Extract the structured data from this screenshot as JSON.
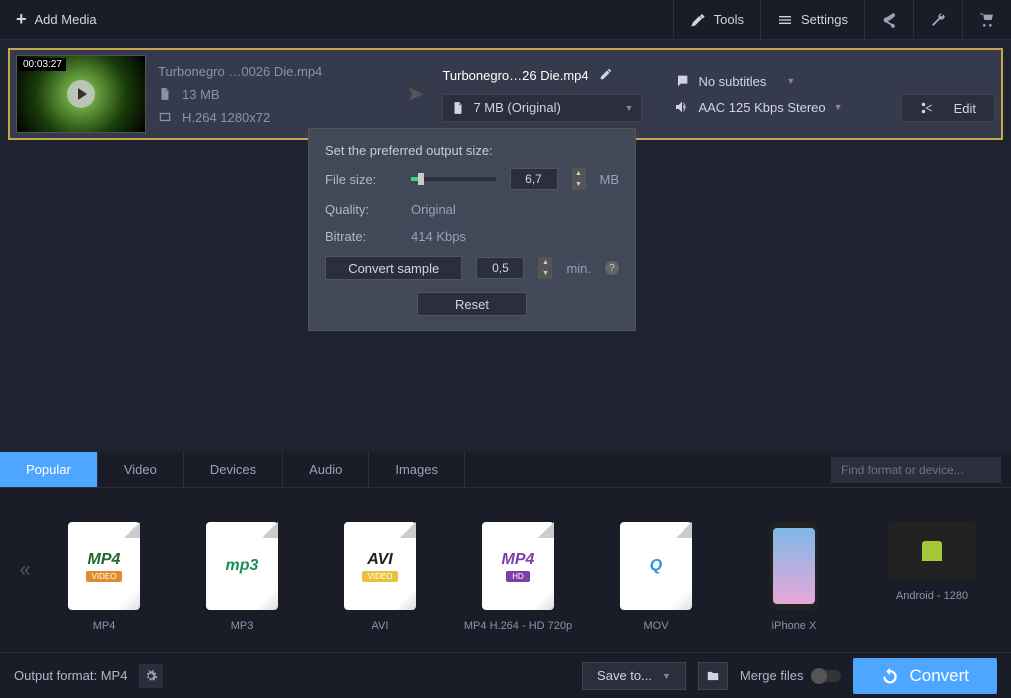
{
  "topbar": {
    "add_media": "Add Media",
    "tools": "Tools",
    "settings": "Settings"
  },
  "file": {
    "duration": "00:03:27",
    "input_name": "Turbonegro  …0026 Die.mp4",
    "size": "13 MB",
    "codec": "H.264 1280x72",
    "output_name": "Turbonegro…26 Die.mp4",
    "output_preset": "7 MB (Original)",
    "subtitles": "No subtitles",
    "audio": "AAC 125 Kbps Stereo",
    "edit": "Edit"
  },
  "popup": {
    "header": "Set the preferred output size:",
    "filesize_label": "File size:",
    "filesize_value": "6,7",
    "filesize_unit": "MB",
    "quality_label": "Quality:",
    "quality_value": "Original",
    "bitrate_label": "Bitrate:",
    "bitrate_value": "414 Kbps",
    "convert_sample": "Convert sample",
    "sample_value": "0,5",
    "sample_unit": "min.",
    "reset": "Reset"
  },
  "tabs": [
    "Popular",
    "Video",
    "Devices",
    "Audio",
    "Images"
  ],
  "search_placeholder": "Find format or device...",
  "formats": [
    {
      "label": "MP4",
      "badge": "MP4",
      "badge_color": "#1b6b2f",
      "sub": "VIDEO",
      "sub_bg": "#e38b2c"
    },
    {
      "label": "MP3",
      "badge": "mp3",
      "badge_color": "#1b8f5a",
      "sub": "",
      "sub_bg": ""
    },
    {
      "label": "AVI",
      "badge": "AVI",
      "badge_color": "#222",
      "sub": "VIDEO",
      "sub_bg": "#e8c23c"
    },
    {
      "label": "MP4 H.264 - HD 720p",
      "badge": "MP4",
      "badge_color": "#7a3fa8",
      "sub": "HD",
      "sub_bg": "#7a3fa8"
    },
    {
      "label": "MOV",
      "badge": "Q",
      "badge_color": "#2e8fe8",
      "sub": "",
      "sub_bg": ""
    },
    {
      "label": "iPhone X",
      "badge": "",
      "badge_color": "",
      "sub": "",
      "sub_bg": "",
      "device": "phone"
    },
    {
      "label": "Android - 1280",
      "badge": "",
      "badge_color": "",
      "sub": "",
      "sub_bg": "",
      "device": "tablet"
    }
  ],
  "bottom": {
    "output_format": "Output format: MP4",
    "save_to": "Save to...",
    "merge": "Merge files",
    "convert": "Convert"
  }
}
